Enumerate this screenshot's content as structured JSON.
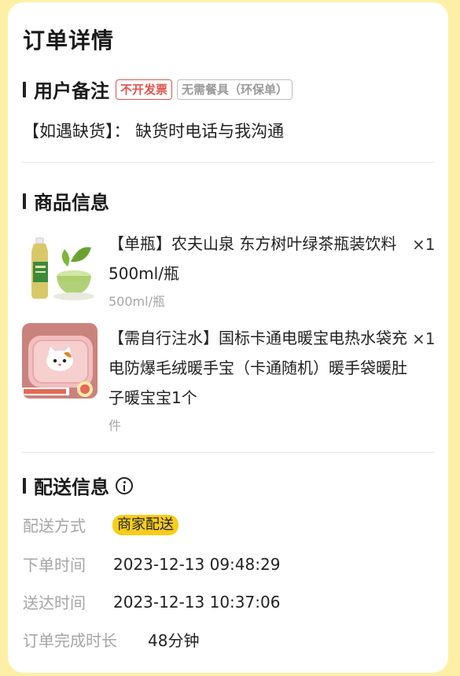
{
  "page": {
    "title": "订单详情"
  },
  "remarks": {
    "section_title": "用户备注",
    "tags": [
      "不开发票",
      "无需餐具（环保单）"
    ],
    "note": "【如遇缺货】：  缺货时电话与我沟通"
  },
  "products": {
    "section_title": "商品信息",
    "items": [
      {
        "name": "【单瓶】农夫山泉 东方树叶绿茶瓶装饮料 500ml/瓶",
        "qty": "×1",
        "spec": "500ml/瓶",
        "image": "green-tea-bottle"
      },
      {
        "name": "【需自行注水】国标卡通电暖宝电热水袋充电防爆毛绒暖手宝（卡通随机）暖手袋暖肚子暖宝宝1个",
        "qty": "×1",
        "spec": "件",
        "image": "pink-hot-water-bag"
      }
    ]
  },
  "delivery": {
    "section_title": "配送信息",
    "info_icon": "info-icon",
    "method_label": "配送方式",
    "method_value": "商家配送",
    "order_time_label": "下单时间",
    "order_time_value": "2023-12-13 09:48:29",
    "arrive_time_label": "送达时间",
    "arrive_time_value": "2023-12-13 10:37:06",
    "duration_label": "订单完成时长",
    "duration_value": "48分钟"
  },
  "colors": {
    "page_background": "#fdf0a6",
    "tag_red": "#e0554e",
    "badge_yellow": "#f8cd1a"
  }
}
